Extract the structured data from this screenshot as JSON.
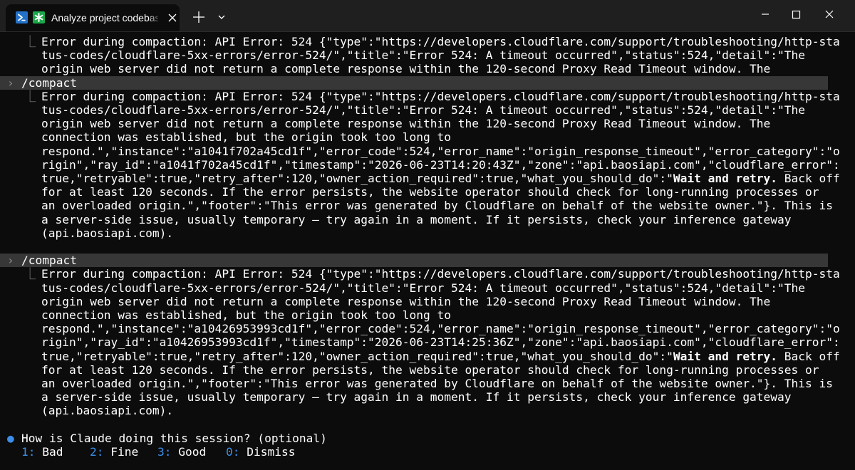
{
  "tab": {
    "title": "Analyze project codebase s"
  },
  "icons": {
    "shell": "powershell-icon",
    "app": "asterisk-icon",
    "close": "close-icon",
    "new_tab": "plus-icon",
    "dropdown": "chevron-down-icon",
    "minimize": "minimize-icon",
    "maximize": "maximize-icon",
    "window_close": "window-close-icon"
  },
  "colors": {
    "terminal_bg": "#0c0c0c",
    "prompt_row_bg": "#373737",
    "accent_blue": "#3b8eea",
    "shell_icon": "#2372c9",
    "app_icon": "#1aa94a"
  },
  "terminal": {
    "block1": [
      "Error during compaction: API Error: 524 {\"type\":\"https://developers.cloudflare.com/support/troubleshooting/http-sta",
      "tus-codes/cloudflare-5xx-errors/error-524/\",\"title\":\"Error 524: A timeout occurred\",\"status\":524,\"detail\":\"The",
      "origin web server did not return a complete response within the 120-second Proxy Read Timeout window. The"
    ],
    "prompt2": "/compact",
    "block2": {
      "lines_before": [
        "Error during compaction: API Error: 524 {\"type\":\"https://developers.cloudflare.com/support/troubleshooting/http-sta",
        "tus-codes/cloudflare-5xx-errors/error-524/\",\"title\":\"Error 524: A timeout occurred\",\"status\":524,\"detail\":\"The",
        "origin web server did not return a complete response within the 120-second Proxy Read Timeout window. The",
        "connection was established, but the origin took too long to",
        "respond.\",\"instance\":\"a1041f702a45cd1f\",\"error_code\":524,\"error_name\":\"origin_response_timeout\",\"error_category\":\"o",
        "rigin\",\"ray_id\":\"a1041f702a45cd1f\",\"timestamp\":\"2026-06-23T14:20:43Z\",\"zone\":\"api.baosiapi.com\",\"cloudflare_error\":"
      ],
      "line7_pre": "true,\"retryable\":true,\"retry_after\":120,\"owner_action_required\":true,\"what_you_should_do\":\"",
      "line7_bold": "Wait and retry.",
      "line7_post": " Back off",
      "lines_after": [
        "for at least 120 seconds. If the error persists, the website operator should check for long-running processes or",
        "an overloaded origin.\",\"footer\":\"This error was generated by Cloudflare on behalf of the website owner.\"}. This is",
        "a server-side issue, usually temporary – try again in a moment. If it persists, check your inference gateway",
        "(api.baosiapi.com)."
      ]
    },
    "prompt3": "/compact",
    "block3": {
      "lines_before": [
        "Error during compaction: API Error: 524 {\"type\":\"https://developers.cloudflare.com/support/troubleshooting/http-sta",
        "tus-codes/cloudflare-5xx-errors/error-524/\",\"title\":\"Error 524: A timeout occurred\",\"status\":524,\"detail\":\"The",
        "origin web server did not return a complete response within the 120-second Proxy Read Timeout window. The",
        "connection was established, but the origin took too long to",
        "respond.\",\"instance\":\"a10426953993cd1f\",\"error_code\":524,\"error_name\":\"origin_response_timeout\",\"error_category\":\"o",
        "rigin\",\"ray_id\":\"a10426953993cd1f\",\"timestamp\":\"2026-06-23T14:25:36Z\",\"zone\":\"api.baosiapi.com\",\"cloudflare_error\":"
      ],
      "line7_pre": "true,\"retryable\":true,\"retry_after\":120,\"owner_action_required\":true,\"what_you_should_do\":\"",
      "line7_bold": "Wait and retry.",
      "line7_post": " Back off",
      "lines_after": [
        "for at least 120 seconds. If the error persists, the website operator should check for long-running processes or",
        "an overloaded origin.\",\"footer\":\"This error was generated by Cloudflare on behalf of the website owner.\"}. This is",
        "a server-side issue, usually temporary – try again in a moment. If it persists, check your inference gateway",
        "(api.baosiapi.com)."
      ]
    },
    "feedback": {
      "question": "How is Claude doing this session? (optional)",
      "options": [
        {
          "key": "1:",
          "label": "Bad"
        },
        {
          "key": "2:",
          "label": "Fine"
        },
        {
          "key": "3:",
          "label": "Good"
        },
        {
          "key": "0:",
          "label": "Dismiss"
        }
      ]
    }
  }
}
